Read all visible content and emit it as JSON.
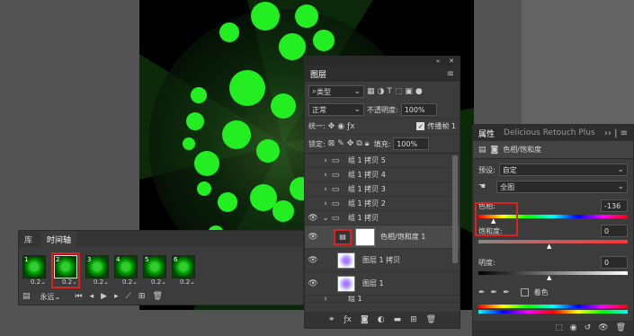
{
  "layers_panel": {
    "title": "图层",
    "filter_kind": "类型",
    "blend_mode": "正常",
    "opacity_label": "不透明度:",
    "opacity_value": "100%",
    "unify_label": "统一:",
    "propagate_label": "传播帧 1",
    "lock_label": "锁定:",
    "fill_label": "填充:",
    "fill_value": "100%",
    "layers": [
      {
        "name": "组 1 拷贝 5",
        "type": "group",
        "visible": false
      },
      {
        "name": "组 1 拷贝 4",
        "type": "group",
        "visible": false
      },
      {
        "name": "组 1 拷贝 3",
        "type": "group",
        "visible": false
      },
      {
        "name": "组 1 拷贝 2",
        "type": "group",
        "visible": false
      },
      {
        "name": "组 1 拷贝",
        "type": "group",
        "visible": true,
        "open": true
      },
      {
        "name": "色相/饱和度 1",
        "type": "adjustment",
        "visible": true
      },
      {
        "name": "图层 1 拷贝",
        "type": "pixel",
        "visible": true
      },
      {
        "name": "图层 1",
        "type": "pixel",
        "visible": true
      },
      {
        "name": "组 1",
        "type": "group",
        "visible": false
      }
    ]
  },
  "properties_panel": {
    "tab_properties": "属性",
    "tab_plugin": "Delicious Retouch Plus",
    "title": "色相/饱和度",
    "preset_label": "预设:",
    "preset_value": "自定",
    "channel_value": "全图",
    "hue_label": "色相:",
    "hue_value": "-136",
    "saturation_label": "饱和度:",
    "saturation_value": "0",
    "lightness_label": "明度:",
    "lightness_value": "0",
    "colorize_label": "着色"
  },
  "timeline_panel": {
    "tab_library": "库",
    "tab_timeline": "时间轴",
    "frames": [
      {
        "num": "1",
        "delay": "0.2"
      },
      {
        "num": "2",
        "delay": "0.2"
      },
      {
        "num": "3",
        "delay": "0.2"
      },
      {
        "num": "4",
        "delay": "0.2"
      },
      {
        "num": "5",
        "delay": "0.2"
      },
      {
        "num": "6",
        "delay": "0.2"
      }
    ],
    "loop_value": "永远"
  },
  "colors": {
    "highlight_red": "#e02020",
    "panel_bg": "#3c3c3c",
    "canvas_green": "#22ee22"
  }
}
